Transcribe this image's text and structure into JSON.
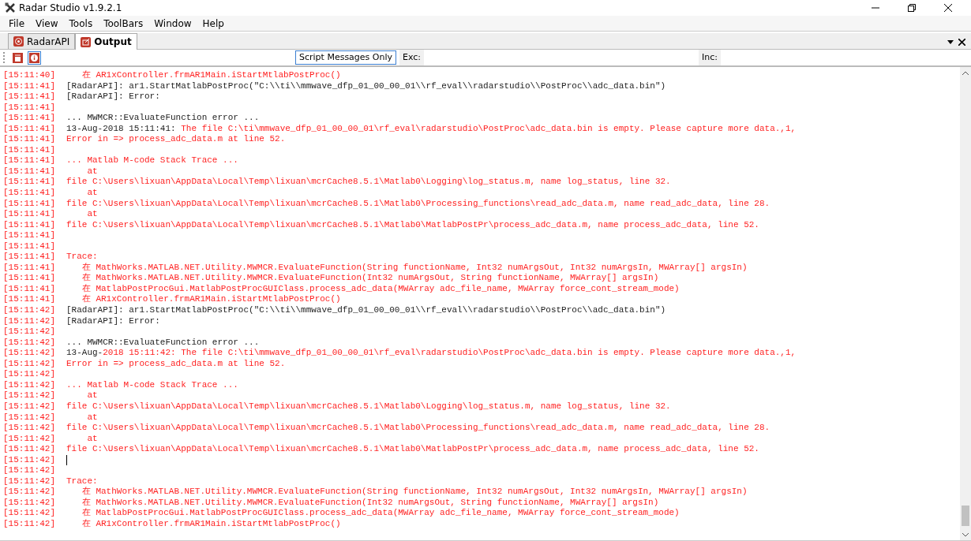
{
  "window": {
    "title": "Radar Studio v1.9.2.1"
  },
  "menu": [
    "File",
    "View",
    "Tools",
    "ToolBars",
    "Window",
    "Help"
  ],
  "tabs": [
    {
      "label": "RadarAPI",
      "selected": false
    },
    {
      "label": "Output",
      "selected": true
    }
  ],
  "toolbar": {
    "icon_buttons": [
      {
        "pressed": false
      },
      {
        "pressed": true
      }
    ],
    "filter_button": {
      "label": "Script Messages Only",
      "pressed": true
    },
    "exclude": {
      "label": "Exc:"
    },
    "include": {
      "label": "Inc:"
    }
  },
  "log": [
    {
      "time": "[15:11:40]",
      "kind": "error",
      "message": "   在 AR1xController.frmAR1Main.iStartMtlabPostProc()"
    },
    {
      "time": "[15:11:41]",
      "kind": "info",
      "message": "[RadarAPI]: ar1.StartMatlabPostProc(\"C:\\\\ti\\\\mmwave_dfp_01_00_00_01\\\\rf_eval\\\\radarstudio\\\\PostProc\\\\adc_data.bin\")"
    },
    {
      "time": "[15:11:41]",
      "kind": "info",
      "message": "[RadarAPI]: Error:"
    },
    {
      "time": "[15:11:41]"
    },
    {
      "time": "[15:11:41]",
      "kind": "info",
      "message": "... MWMCR::EvaluateFunction error ..."
    },
    {
      "time": "[15:11:41]",
      "parts": [
        {
          "kind": "info",
          "text": "13-Aug-2018 15:11:41:"
        },
        {
          "kind": "error",
          "text": " The file C:\\ti\\mmwave_dfp_01_00_00_01\\rf_eval\\radarstudio\\PostProc\\adc_data.bin is empty. Please capture more data.,1,"
        }
      ]
    },
    {
      "time": "[15:11:41]",
      "kind": "error",
      "message": "Error in => process_adc_data.m at line 52."
    },
    {
      "time": "[15:11:41]"
    },
    {
      "time": "[15:11:41]",
      "kind": "error",
      "message": "... Matlab M-code Stack Trace ..."
    },
    {
      "time": "[15:11:41]",
      "kind": "error",
      "message": "    at"
    },
    {
      "time": "[15:11:41]",
      "kind": "error",
      "message": "file C:\\Users\\lixuan\\AppData\\Local\\Temp\\lixuan\\mcrCache8.5.1\\Matlab0\\Logging\\log_status.m, name log_status, line 32."
    },
    {
      "time": "[15:11:41]",
      "kind": "error",
      "message": "    at"
    },
    {
      "time": "[15:11:41]",
      "kind": "error",
      "message": "file C:\\Users\\lixuan\\AppData\\Local\\Temp\\lixuan\\mcrCache8.5.1\\Matlab0\\Processing_functions\\read_adc_data.m, name read_adc_data, line 28."
    },
    {
      "time": "[15:11:41]",
      "kind": "error",
      "message": "    at"
    },
    {
      "time": "[15:11:41]",
      "kind": "error",
      "message": "file C:\\Users\\lixuan\\AppData\\Local\\Temp\\lixuan\\mcrCache8.5.1\\Matlab0\\MatlabPostPr\\process_adc_data.m, name process_adc_data, line 52."
    },
    {
      "time": "[15:11:41]"
    },
    {
      "time": "[15:11:41]"
    },
    {
      "time": "[15:11:41]",
      "kind": "error",
      "message": "Trace:"
    },
    {
      "time": "[15:11:41]",
      "kind": "error",
      "message": "   在 MathWorks.MATLAB.NET.Utility.MWMCR.EvaluateFunction(String functionName, Int32 numArgsOut, Int32 numArgsIn, MWArray[] argsIn)"
    },
    {
      "time": "[15:11:41]",
      "kind": "error",
      "message": "   在 MathWorks.MATLAB.NET.Utility.MWMCR.EvaluateFunction(Int32 numArgsOut, String functionName, MWArray[] argsIn)"
    },
    {
      "time": "[15:11:41]",
      "kind": "error",
      "message": "   在 MatlabPostProcGui.MatlabPostProcGUIClass.process_adc_data(MWArray adc_file_name, MWArray force_cont_stream_mode)"
    },
    {
      "time": "[15:11:41]",
      "kind": "error",
      "message": "   在 AR1xController.frmAR1Main.iStartMtlabPostProc()"
    },
    {
      "time": "[15:11:42]",
      "kind": "info",
      "message": "[RadarAPI]: ar1.StartMatlabPostProc(\"C:\\\\ti\\\\mmwave_dfp_01_00_00_01\\\\rf_eval\\\\radarstudio\\\\PostProc\\\\adc_data.bin\")"
    },
    {
      "time": "[15:11:42]",
      "kind": "info",
      "message": "[RadarAPI]: Error:"
    },
    {
      "time": "[15:11:42]"
    },
    {
      "time": "[15:11:42]",
      "kind": "info",
      "message": "... MWMCR::EvaluateFunction error ..."
    },
    {
      "time": "[15:11:42]",
      "parts": [
        {
          "kind": "info",
          "text": "13-Aug-"
        },
        {
          "kind": "error",
          "text": "2018 15:11:42: The file C:\\ti\\mmwave_dfp_01_00_00_01\\rf_eval\\radarstudio\\PostProc\\adc_data.bin is empty. Please capture more data.,1,"
        }
      ]
    },
    {
      "time": "[15:11:42]",
      "kind": "error",
      "message": "Error in => process_adc_data.m at line 52."
    },
    {
      "time": "[15:11:42]"
    },
    {
      "time": "[15:11:42]",
      "kind": "error",
      "message": "... Matlab M-code Stack Trace ..."
    },
    {
      "time": "[15:11:42]",
      "kind": "error",
      "message": "    at"
    },
    {
      "time": "[15:11:42]",
      "kind": "error",
      "message": "file C:\\Users\\lixuan\\AppData\\Local\\Temp\\lixuan\\mcrCache8.5.1\\Matlab0\\Logging\\log_status.m, name log_status, line 32."
    },
    {
      "time": "[15:11:42]",
      "kind": "error",
      "message": "    at"
    },
    {
      "time": "[15:11:42]",
      "kind": "error",
      "message": "file C:\\Users\\lixuan\\AppData\\Local\\Temp\\lixuan\\mcrCache8.5.1\\Matlab0\\Processing_functions\\read_adc_data.m, name read_adc_data, line 28."
    },
    {
      "time": "[15:11:42]",
      "kind": "error",
      "message": "    at"
    },
    {
      "time": "[15:11:42]",
      "kind": "error",
      "message": "file C:\\Users\\lixuan\\AppData\\Local\\Temp\\lixuan\\mcrCache8.5.1\\Matlab0\\MatlabPostPr\\process_adc_data.m, name process_adc_data, line 52."
    },
    {
      "time": "[15:11:42]",
      "cursor": true
    },
    {
      "time": "[15:11:42]"
    },
    {
      "time": "[15:11:42]",
      "kind": "error",
      "message": "Trace:"
    },
    {
      "time": "[15:11:42]",
      "kind": "error",
      "message": "   在 MathWorks.MATLAB.NET.Utility.MWMCR.EvaluateFunction(String functionName, Int32 numArgsOut, Int32 numArgsIn, MWArray[] argsIn)"
    },
    {
      "time": "[15:11:42]",
      "kind": "error",
      "message": "   在 MathWorks.MATLAB.NET.Utility.MWMCR.EvaluateFunction(Int32 numArgsOut, String functionName, MWArray[] argsIn)"
    },
    {
      "time": "[15:11:42]",
      "kind": "error",
      "message": "   在 MatlabPostProcGui.MatlabPostProcGUIClass.process_adc_data(MWArray adc_file_name, MWArray force_cont_stream_mode)"
    },
    {
      "time": "[15:11:42]",
      "kind": "error",
      "message": "   在 AR1xController.frmAR1Main.iStartMtlabPostProc()"
    }
  ]
}
